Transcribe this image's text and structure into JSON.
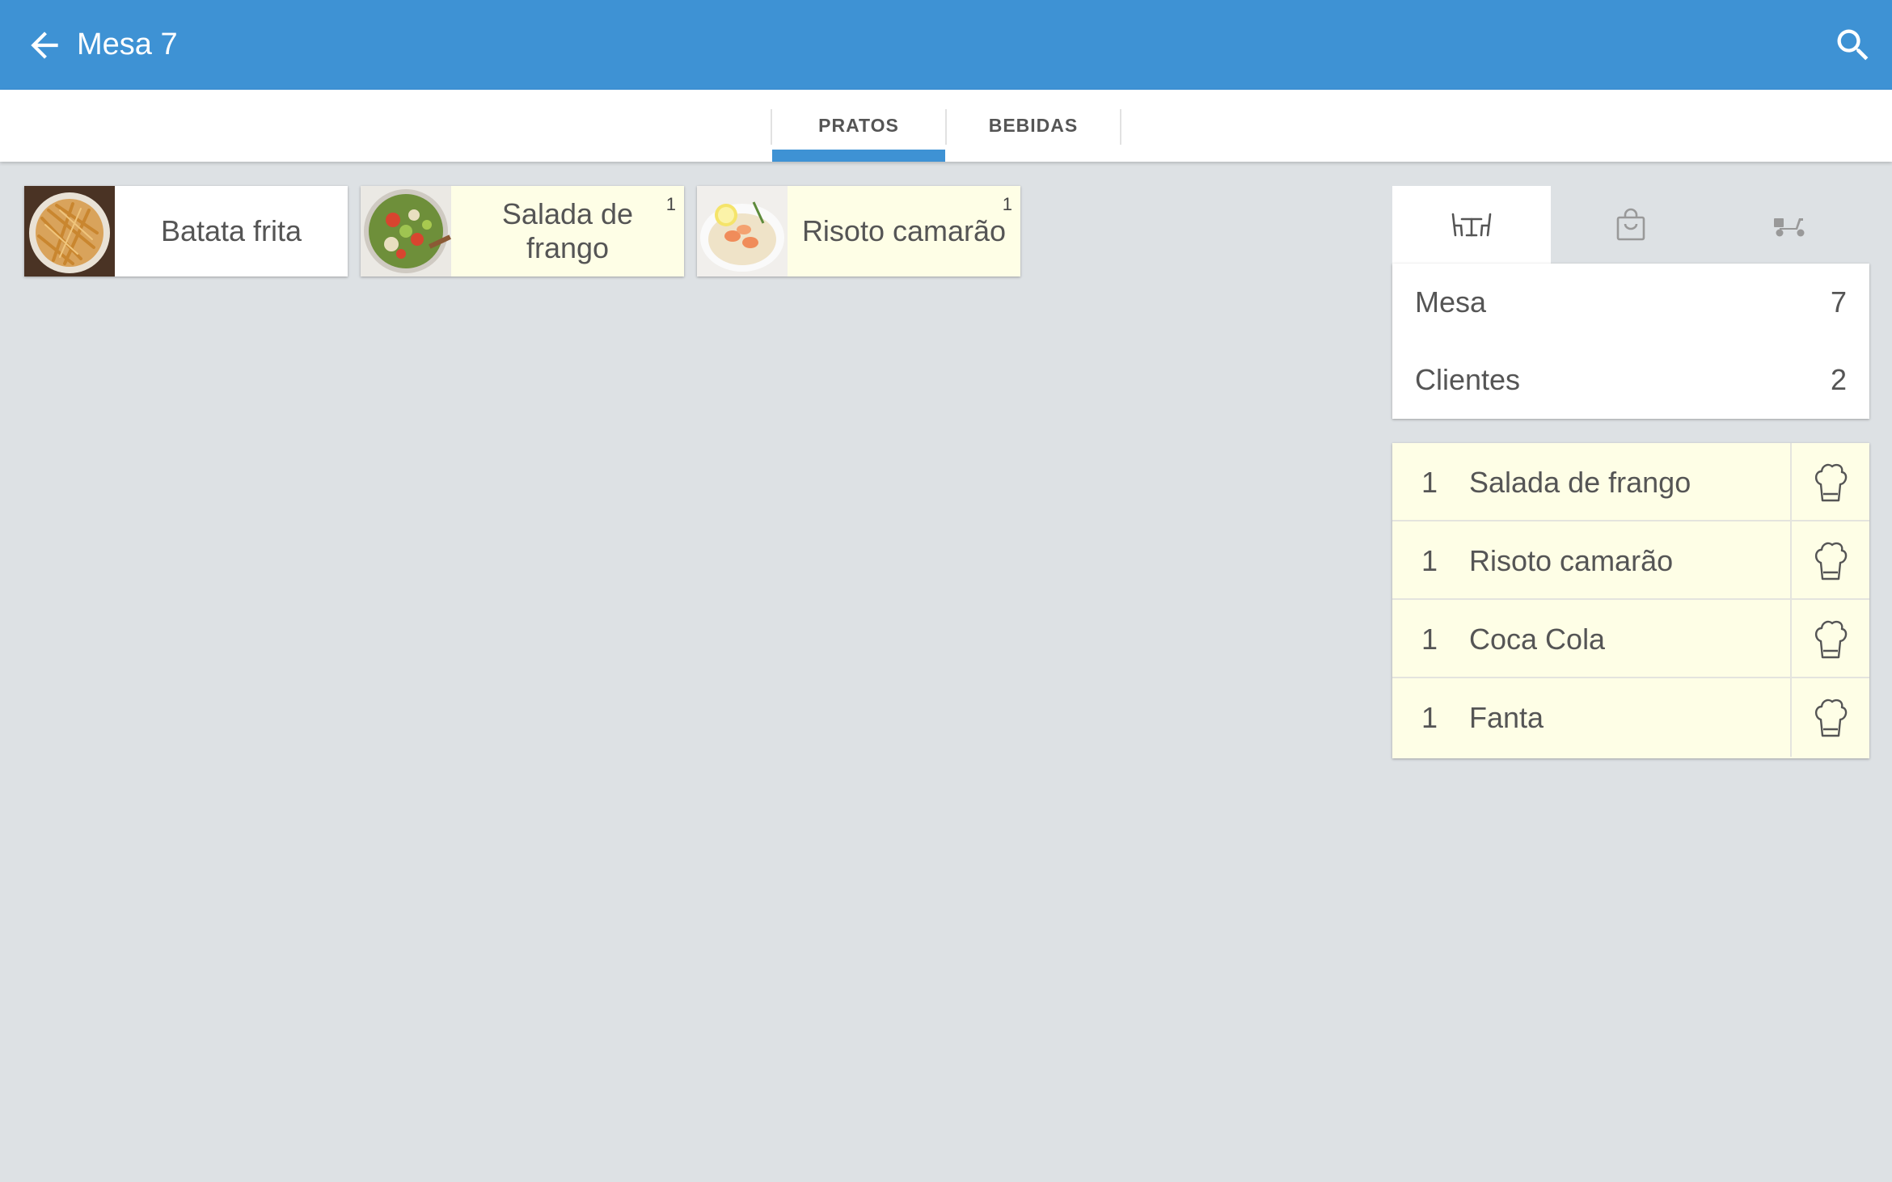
{
  "appbar": {
    "title": "Mesa 7",
    "back_icon": "arrow-back-icon",
    "search_icon": "search-icon",
    "background": "#3e92d4"
  },
  "tabs": [
    {
      "label": "PRATOS",
      "active": true
    },
    {
      "label": "BEBIDAS",
      "active": false
    }
  ],
  "products": [
    {
      "name": "Batata frita",
      "image": "fries-photo",
      "count": "",
      "highlighted": false
    },
    {
      "name": "Salada de frango",
      "image": "salad-photo",
      "count": "1",
      "highlighted": true
    },
    {
      "name": "Risoto camarão",
      "image": "risotto-photo",
      "count": "1",
      "highlighted": true
    }
  ],
  "panel": {
    "mode_tabs": [
      {
        "icon": "table-dining-icon",
        "active": true
      },
      {
        "icon": "shopping-bag-icon",
        "active": false
      },
      {
        "icon": "delivery-scooter-icon",
        "active": false
      }
    ],
    "info": [
      {
        "label": "Mesa",
        "value": "7"
      },
      {
        "label": "Clientes",
        "value": "2"
      }
    ],
    "orders": [
      {
        "qty": "1",
        "name": "Salada de frango",
        "action_icon": "chef-hat-icon"
      },
      {
        "qty": "1",
        "name": "Risoto camarão",
        "action_icon": "chef-hat-icon"
      },
      {
        "qty": "1",
        "name": "Coca Cola",
        "action_icon": "chef-hat-icon"
      },
      {
        "qty": "1",
        "name": "Fanta",
        "action_icon": "chef-hat-icon"
      }
    ]
  },
  "colors": {
    "accent": "#3e92d4",
    "background": "#dde1e4",
    "highlight_card": "#fefee6"
  }
}
